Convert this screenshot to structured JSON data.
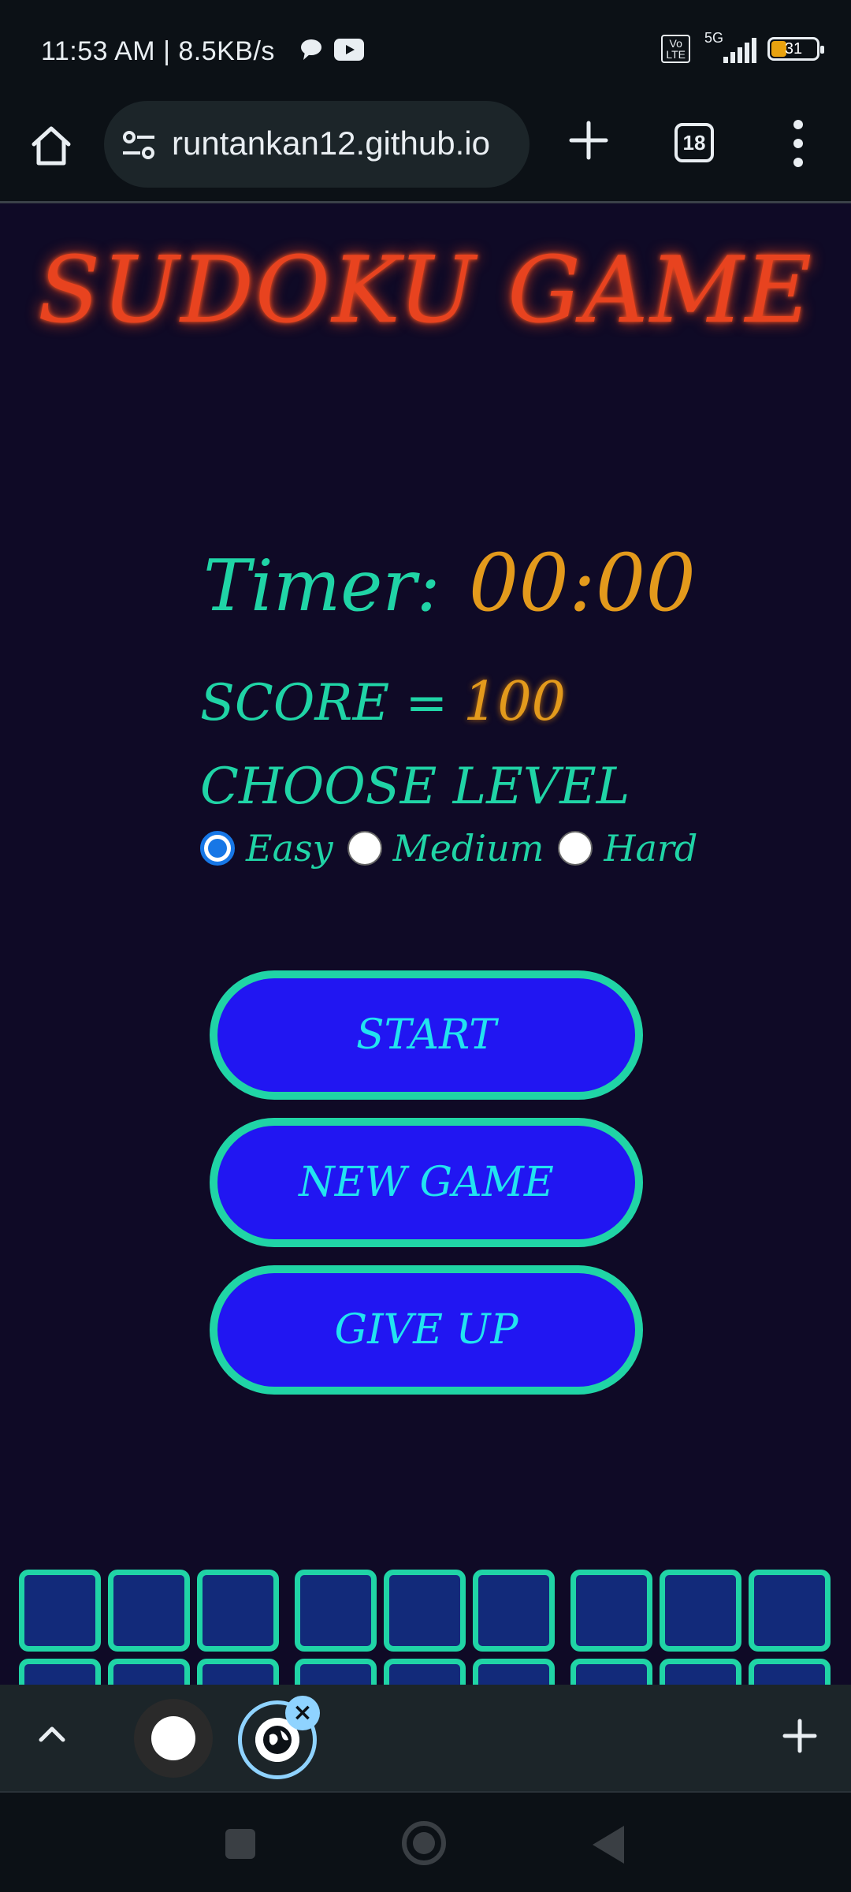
{
  "status_bar": {
    "time": "11:53 AM | 8.5KB/s",
    "volte": "Vo\nLTE",
    "network": "5G",
    "battery": "31"
  },
  "browser": {
    "url": "runtankan12.github.io",
    "tab_count": "18"
  },
  "game": {
    "title": "SUDOKU GAME",
    "timer_label": "Timer:",
    "timer_value": "00:00",
    "score_label": "SCORE =",
    "score_value": "100",
    "level_label": "CHOOSE LEVEL",
    "levels": [
      {
        "label": "Easy",
        "checked": true
      },
      {
        "label": "Medium",
        "checked": false
      },
      {
        "label": "Hard",
        "checked": false
      }
    ],
    "buttons": {
      "start": "START",
      "new_game": "NEW GAME",
      "give_up": "GIVE UP"
    }
  },
  "colors": {
    "background": "#0f0a26",
    "title": "#e8431f",
    "accent_green": "#20d4a6",
    "accent_orange": "#e39a1c",
    "button_fill": "#2116f2",
    "button_text": "#22e3f0",
    "cell_fill": "#122a7a"
  },
  "icons": {
    "home": "home-icon",
    "site_settings": "tune-icon",
    "new_tab": "plus-icon",
    "tabs": "tab-switcher-icon",
    "menu": "more-vert-icon",
    "tab_strip_toggle": "chevron-up-icon",
    "close_tab": "close-icon",
    "add_tab": "plus-icon"
  }
}
